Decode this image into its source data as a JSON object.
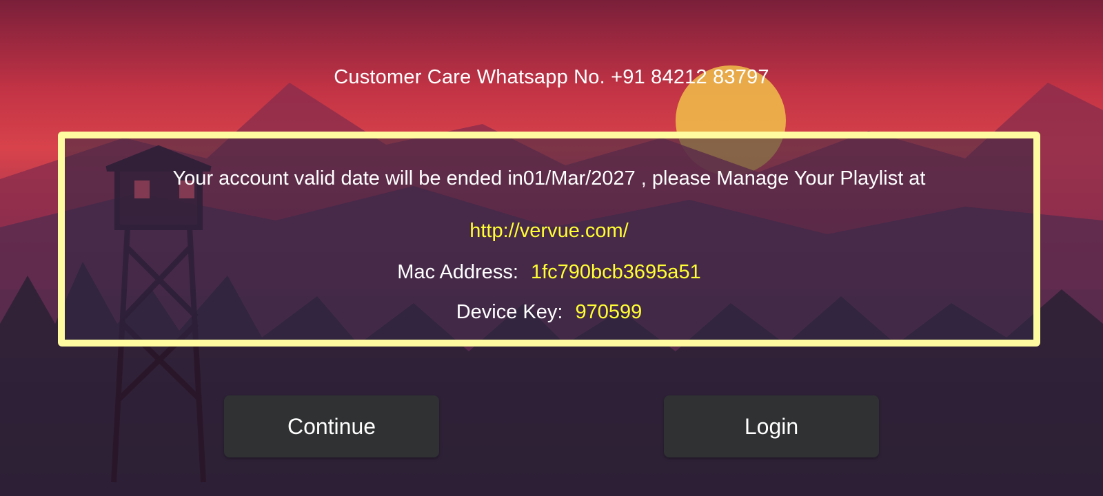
{
  "header": {
    "whatsapp_text": "Customer Care Whatsapp No. +91 84212 83797"
  },
  "info": {
    "validity_message": "Your account valid date will be ended in01/Mar/2027 , please Manage Your Playlist at",
    "url": "http://vervue.com/",
    "mac_label": "Mac Address:",
    "mac_value": "1fc790bcb3695a51",
    "device_key_label": "Device Key:",
    "device_key_value": "970599"
  },
  "buttons": {
    "continue_label": "Continue",
    "login_label": "Login"
  },
  "colors": {
    "box_border": "#fefba0",
    "highlight_text": "#ffff33",
    "button_bg": "#2f3133"
  }
}
